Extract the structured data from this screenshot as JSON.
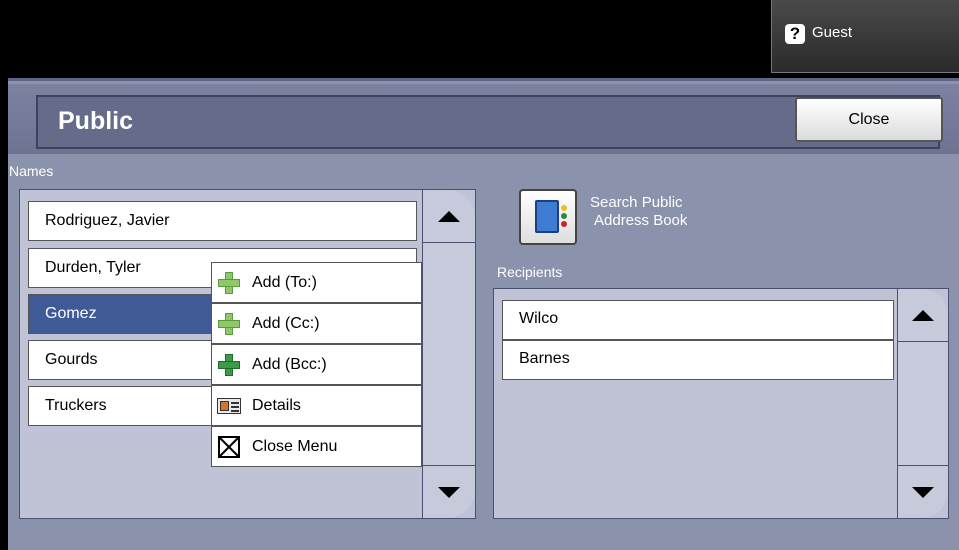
{
  "top_bar": {
    "user_label": "Guest",
    "help_glyph": "?"
  },
  "header": {
    "title": "Public",
    "close_label": "Close"
  },
  "names": {
    "label": "Names",
    "items": [
      {
        "label": "Rodriguez, Javier"
      },
      {
        "label": "Durden, Tyler"
      },
      {
        "label": "Gomez",
        "selected": true
      },
      {
        "label": "Gourds"
      },
      {
        "label": "Truckers"
      }
    ]
  },
  "context_menu": {
    "items": [
      {
        "label": "Add (To:)",
        "icon": "add-green-icon"
      },
      {
        "label": "Add (Cc:)",
        "icon": "add-green-icon"
      },
      {
        "label": "Add (Bcc:)",
        "icon": "add-dark-green-icon"
      },
      {
        "label": "Details",
        "icon": "details-card-icon"
      },
      {
        "label": "Close Menu",
        "icon": "close-box-icon"
      }
    ]
  },
  "search": {
    "label_line1": "Search Public",
    "label_line2": "Address Book",
    "icon": "address-book-icon"
  },
  "recipients": {
    "label": "Recipients",
    "items": [
      {
        "label": "Wilco"
      },
      {
        "label": "Barnes"
      }
    ]
  },
  "colors": {
    "panel": "#8a92ac",
    "selected": "#3f5a96",
    "list_bg": "#bfc3d5"
  }
}
